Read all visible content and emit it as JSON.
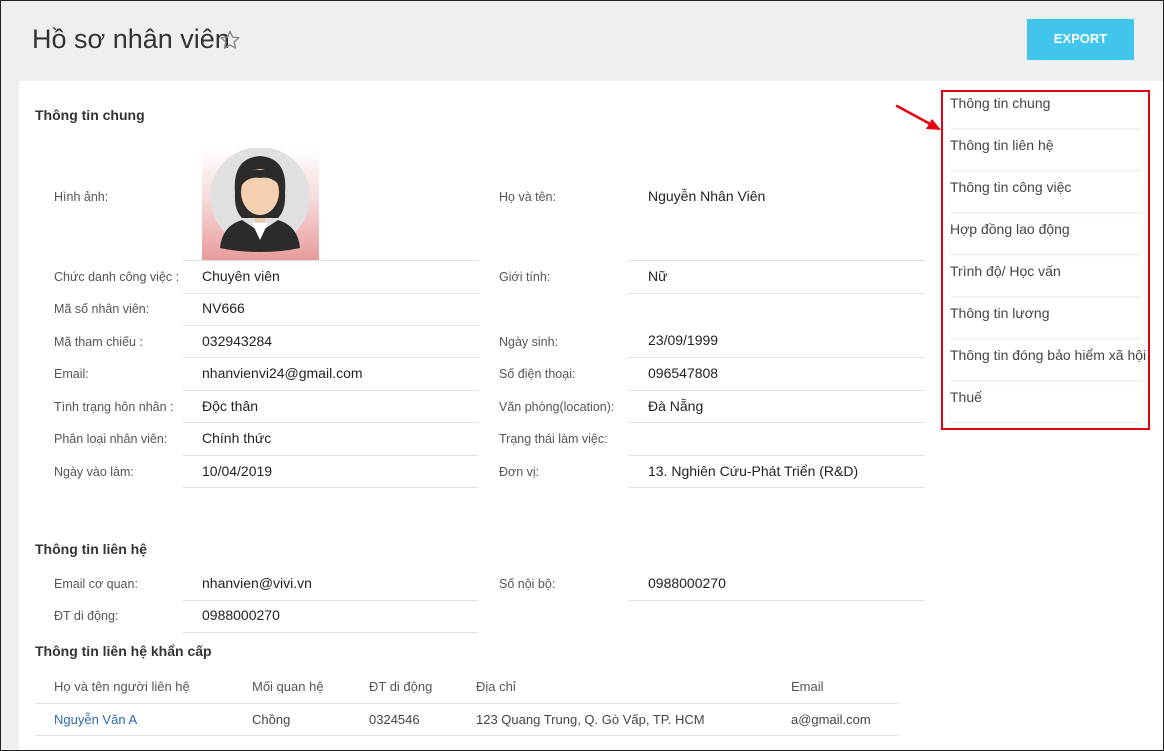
{
  "page": {
    "title": "Hồ sơ nhân viên",
    "export_label": "EXPORT"
  },
  "general": {
    "section_title": "Thông tin chung",
    "photo_label": "Hình ảnh:",
    "fullname_label": "Họ và tên:",
    "fullname": "Nguyễn Nhân Viên",
    "job_title_label": "Chức danh công việc :",
    "job_title": "Chuyên viên",
    "gender_label": "Giới tính:",
    "gender": "Nữ",
    "employee_id_label": "Mã số nhân viên:",
    "employee_id": "NV666",
    "reference_code_label": "Mã tham chiếu :",
    "reference_code": "032943284",
    "birthday_label": "Ngày sinh:",
    "birthday": "23/09/1999",
    "email_label": "Email:",
    "email": "nhanvienvi24@gmail.com",
    "phone_label": "Số điện thoại:",
    "phone": "096547808",
    "marital_label": "Tình trạng hôn nhân :",
    "marital": "Độc thân",
    "office_label": "Văn phòng(location):",
    "office": "Đà Nẵng",
    "employee_type_label": "Phân loại nhân viên:",
    "employee_type": "Chính thức",
    "work_status_label": "Trạng thái làm việc:",
    "work_status": "",
    "start_date_label": "Ngày vào làm:",
    "start_date": "10/04/2019",
    "unit_label": "Đơn vị:",
    "unit": "13. Nghiên Cứu-Phát Triển (R&D)"
  },
  "contact": {
    "section_title": "Thông tin liên hệ",
    "work_email_label": "Email cơ quan:",
    "work_email": "nhanvien@vivi.vn",
    "internal_label": "Số nội bộ:",
    "internal": "0988000270",
    "mobile_label": "ĐT di động:",
    "mobile": "0988000270"
  },
  "emergency": {
    "section_title": "Thông tin liên hệ khẩn cấp",
    "columns": [
      "Họ và tên người liên hệ",
      "Mối quan hệ",
      "ĐT di động",
      "Địa chỉ",
      "Email"
    ],
    "rows": [
      [
        "Nguyễn Văn A",
        "Chồng",
        "0324546",
        "123 Quang Trung, Q. Gò Vấp, TP. HCM",
        "a@gmail.com"
      ]
    ]
  },
  "side_nav": {
    "items": [
      "Thông tin chung",
      "Thông tin liên hệ",
      "Thông tin công việc",
      "Hợp đồng lao động",
      "Trình độ/ Học vấn",
      "Thông tin lương",
      "Thông tin đóng bảo hiểm xã hội",
      "Thuế"
    ]
  },
  "colors": {
    "accent": "#41c5ec",
    "highlight": "#e3000f",
    "link": "#2a6ab0",
    "header_bg": "#edf0f3"
  }
}
